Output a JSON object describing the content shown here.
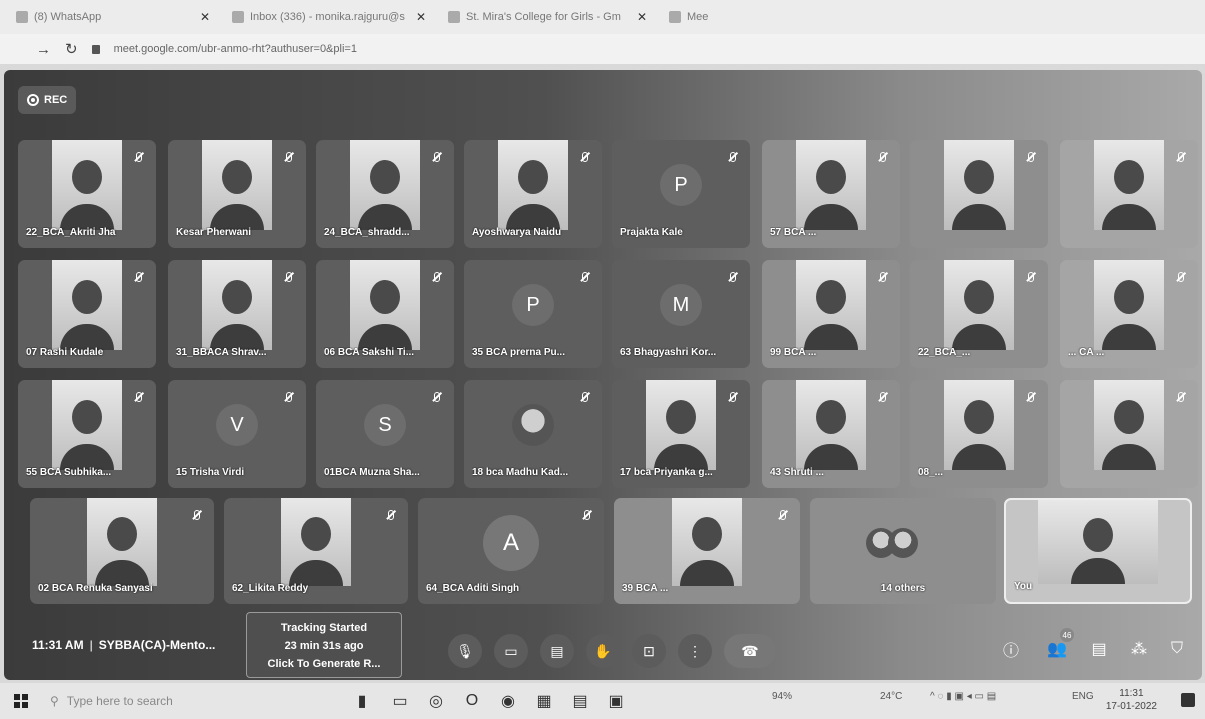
{
  "browser": {
    "tabs": [
      {
        "title": "(8) WhatsApp"
      },
      {
        "title": "Inbox (336) - monika.rajguru@s"
      },
      {
        "title": "St. Mira's College for Girls - Gm"
      },
      {
        "title": "Mee"
      }
    ],
    "url": "meet.google.com/ubr-anmo-rht?authuser=0&pli=1"
  },
  "meet": {
    "rec_label": "REC",
    "tiles": [
      {
        "name": "22_BCA_Akriti Jha",
        "kind": "video"
      },
      {
        "name": "Kesar Pherwani",
        "kind": "video"
      },
      {
        "name": "24_BCA_shradd...",
        "kind": "video"
      },
      {
        "name": "Ayoshwarya Naidu",
        "kind": "video"
      },
      {
        "name": "Prajakta Kale",
        "kind": "avatar",
        "initial": "P"
      },
      {
        "name": "57 BCA ...",
        "kind": "video"
      },
      {
        "name": "",
        "kind": "video"
      },
      {
        "name": "",
        "kind": "video"
      },
      {
        "name": "07 Rashi Kudale",
        "kind": "video"
      },
      {
        "name": "31_BBACA Shrav...",
        "kind": "video"
      },
      {
        "name": "06 BCA Sakshi Ti...",
        "kind": "video"
      },
      {
        "name": "35 BCA prerna Pu...",
        "kind": "avatar",
        "initial": "P"
      },
      {
        "name": "63 Bhagyashri Kor...",
        "kind": "avatar",
        "initial": "M"
      },
      {
        "name": "99 BCA ...",
        "kind": "video"
      },
      {
        "name": "22_BCA_...",
        "kind": "video"
      },
      {
        "name": "... CA ...",
        "kind": "video"
      },
      {
        "name": "55 BCA Subhika...",
        "kind": "video"
      },
      {
        "name": "15 Trisha Virdi",
        "kind": "avatar",
        "initial": "V"
      },
      {
        "name": "01BCA Muzna Sha...",
        "kind": "avatar",
        "initial": "S"
      },
      {
        "name": "18 bca Madhu Kad...",
        "kind": "photo"
      },
      {
        "name": "17 bca Priyanka g...",
        "kind": "video"
      },
      {
        "name": "43 Shruti ...",
        "kind": "video"
      },
      {
        "name": "08_...",
        "kind": "video"
      },
      {
        "name": "",
        "kind": "video"
      },
      {
        "name": "02 BCA Renuka Sanyasi",
        "kind": "video"
      },
      {
        "name": "62_Likita Reddy",
        "kind": "video"
      },
      {
        "name": "64_BCA Aditi Singh",
        "kind": "avatar",
        "initial": "A"
      },
      {
        "name": "39 BCA ...",
        "kind": "video"
      },
      {
        "name": "14 others",
        "kind": "group"
      },
      {
        "name": "You",
        "kind": "self"
      }
    ],
    "time": "11:31 AM",
    "meeting_title": "SYBBA(CA)-Mento...",
    "tracking": {
      "line1": "Tracking Started",
      "line2": "23 min 31s ago",
      "line3": "Click To Generate R..."
    },
    "participants_badge": "46"
  },
  "taskbar": {
    "search_placeholder": "Type here to search",
    "battery": "94%",
    "weather": "24°C",
    "lang": "ENG",
    "time": "11:31",
    "date": "17-01-2022"
  }
}
